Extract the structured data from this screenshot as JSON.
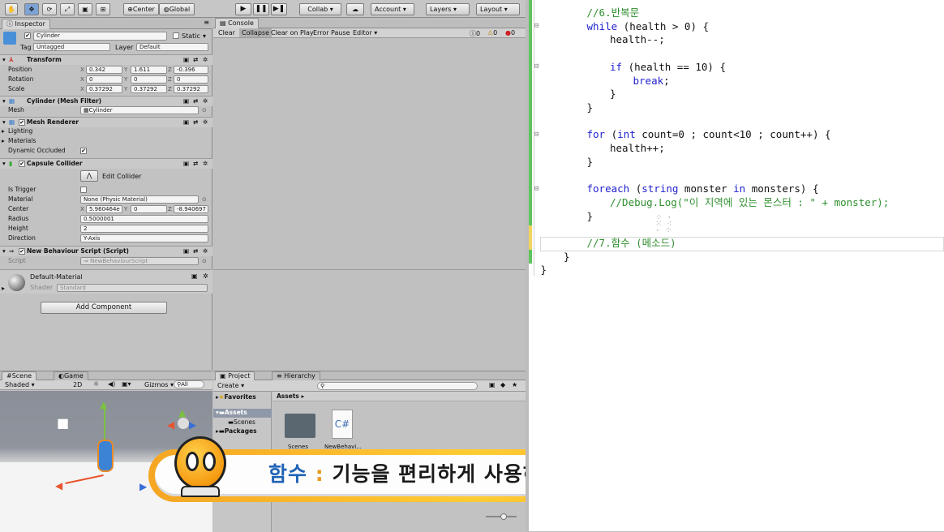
{
  "toolbar": {
    "center": "Center",
    "global": "Global",
    "collab": "Collab ▾",
    "account": "Account",
    "layers": "Layers",
    "layout": "Layout"
  },
  "inspector": {
    "tab": "Inspector",
    "object_name": "Cylinder",
    "static_label": "Static",
    "tag_label": "Tag",
    "tag_value": "Untagged",
    "layer_label": "Layer",
    "layer_value": "Default",
    "transform": {
      "title": "Transform",
      "position_label": "Position",
      "rotation_label": "Rotation",
      "scale_label": "Scale",
      "position": [
        "0.342",
        "1.611",
        "-0.396"
      ],
      "rotation": [
        "0",
        "0",
        "0"
      ],
      "scale": [
        "0.37292",
        "0.37292",
        "0.37292"
      ]
    },
    "mesh_filter": {
      "title": "Cylinder (Mesh Filter)",
      "mesh_label": "Mesh",
      "mesh_value": "Cylinder"
    },
    "mesh_renderer": {
      "title": "Mesh Renderer",
      "lighting": "Lighting",
      "materials": "Materials",
      "dynamic_occluded": "Dynamic Occluded"
    },
    "capsule_collider": {
      "title": "Capsule Collider",
      "edit_collider": "Edit Collider",
      "is_trigger": "Is Trigger",
      "material_label": "Material",
      "material_value": "None (Physic Material)",
      "center_label": "Center",
      "center": [
        "5.960464e",
        "0",
        "-8.940697"
      ],
      "radius_label": "Radius",
      "radius_value": "0.5000001",
      "height_label": "Height",
      "height_value": "2",
      "direction_label": "Direction",
      "direction_value": "Y-Axis"
    },
    "script_comp": {
      "title": "New Behaviour Script (Script)",
      "script_label": "Script",
      "script_value": "NewBehaviourScript"
    },
    "material": {
      "name": "Default-Material",
      "shader_label": "Shader",
      "shader_value": "Standard"
    },
    "add_component": "Add Component"
  },
  "console": {
    "tab": "Console",
    "clear": "Clear",
    "collapse": "Collapse",
    "clear_on_play": "Clear on Play",
    "error_pause": "Error Pause",
    "editor": "Editor",
    "counts": [
      "0",
      "0",
      "0"
    ]
  },
  "scene": {
    "tab_scene": "Scene",
    "tab_game": "Game",
    "shaded": "Shaded",
    "mode_2d": "2D",
    "gizmos": "Gizmos",
    "all": "All"
  },
  "project": {
    "tab_project": "Project",
    "tab_hierarchy": "Hierarchy",
    "create": "Create",
    "favorites": "Favorites",
    "assets_breadcrumb": "Assets",
    "tree_assets": "Assets",
    "tree_scenes": "Scenes",
    "tree_packages": "Packages",
    "items": [
      "Scenes",
      "NewBehavi..."
    ],
    "script_glyph": "C#"
  },
  "caption": {
    "term": "함수",
    "colon": ":",
    "text": "기능을 편리하게 사용하도록 구성된 영역"
  },
  "code": {
    "lines": [
      {
        "indent": 2,
        "parts": [
          {
            "t": "//6.반복문",
            "c": "cm"
          }
        ]
      },
      {
        "indent": 2,
        "parts": [
          {
            "t": "while",
            "c": "kw"
          },
          {
            "t": " (health > 0) {",
            "c": ""
          }
        ]
      },
      {
        "indent": 3,
        "parts": [
          {
            "t": "health--;",
            "c": ""
          }
        ]
      },
      {
        "indent": 3,
        "parts": []
      },
      {
        "indent": 3,
        "parts": [
          {
            "t": "if",
            "c": "kw"
          },
          {
            "t": " (health == 10) {",
            "c": ""
          }
        ]
      },
      {
        "indent": 4,
        "parts": [
          {
            "t": "break",
            "c": "kw"
          },
          {
            "t": ";",
            "c": ""
          }
        ]
      },
      {
        "indent": 3,
        "parts": [
          {
            "t": "}",
            "c": ""
          }
        ]
      },
      {
        "indent": 2,
        "parts": [
          {
            "t": "}",
            "c": ""
          }
        ]
      },
      {
        "indent": 2,
        "parts": []
      },
      {
        "indent": 2,
        "parts": [
          {
            "t": "for",
            "c": "kw"
          },
          {
            "t": " (",
            "c": ""
          },
          {
            "t": "int",
            "c": "kw"
          },
          {
            "t": " count=0 ; count<10 ; count++) {",
            "c": ""
          }
        ]
      },
      {
        "indent": 3,
        "parts": [
          {
            "t": "health++;",
            "c": ""
          }
        ]
      },
      {
        "indent": 2,
        "parts": [
          {
            "t": "}",
            "c": ""
          }
        ]
      },
      {
        "indent": 2,
        "parts": []
      },
      {
        "indent": 2,
        "parts": [
          {
            "t": "foreach",
            "c": "kw"
          },
          {
            "t": " (",
            "c": ""
          },
          {
            "t": "string",
            "c": "kw"
          },
          {
            "t": " monster ",
            "c": ""
          },
          {
            "t": "in",
            "c": "kw"
          },
          {
            "t": " monsters) {",
            "c": ""
          }
        ]
      },
      {
        "indent": 3,
        "parts": [
          {
            "t": "//Debug.Log(\"이 지역에 있는 몬스터 : \" + monster);",
            "c": "cm"
          }
        ]
      },
      {
        "indent": 2,
        "parts": [
          {
            "t": "}",
            "c": ""
          }
        ]
      },
      {
        "indent": 2,
        "parts": []
      },
      {
        "indent": 2,
        "parts": [
          {
            "t": "//7.함수 (메소드)",
            "c": "cm"
          }
        ]
      },
      {
        "indent": 1,
        "parts": [
          {
            "t": "}",
            "c": ""
          }
        ]
      },
      {
        "indent": 0,
        "parts": [
          {
            "t": "}",
            "c": ""
          }
        ]
      }
    ]
  }
}
